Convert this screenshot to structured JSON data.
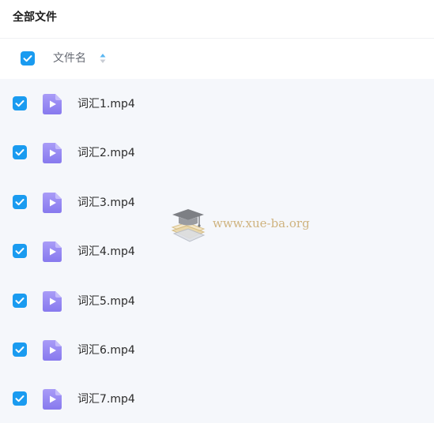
{
  "header": {
    "title": "全部文件"
  },
  "columns": {
    "name_label": "文件名",
    "sort_icon": "sort-caret-icon",
    "select_all_checked": true
  },
  "files": [
    {
      "name": "词汇1.mp4",
      "checked": true,
      "icon": "video-file-icon"
    },
    {
      "name": "词汇2.mp4",
      "checked": true,
      "icon": "video-file-icon"
    },
    {
      "name": "词汇3.mp4",
      "checked": true,
      "icon": "video-file-icon"
    },
    {
      "name": "词汇4.mp4",
      "checked": true,
      "icon": "video-file-icon"
    },
    {
      "name": "词汇5.mp4",
      "checked": true,
      "icon": "video-file-icon"
    },
    {
      "name": "词汇6.mp4",
      "checked": true,
      "icon": "video-file-icon"
    },
    {
      "name": "词汇7.mp4",
      "checked": true,
      "icon": "video-file-icon"
    }
  ],
  "watermark": {
    "text": "www.xue-ba.org",
    "icon": "graduation-cap-logo"
  },
  "colors": {
    "accent": "#1a9bf0",
    "file_icon": "#8b7ff0",
    "list_background": "#f5f7fb"
  }
}
